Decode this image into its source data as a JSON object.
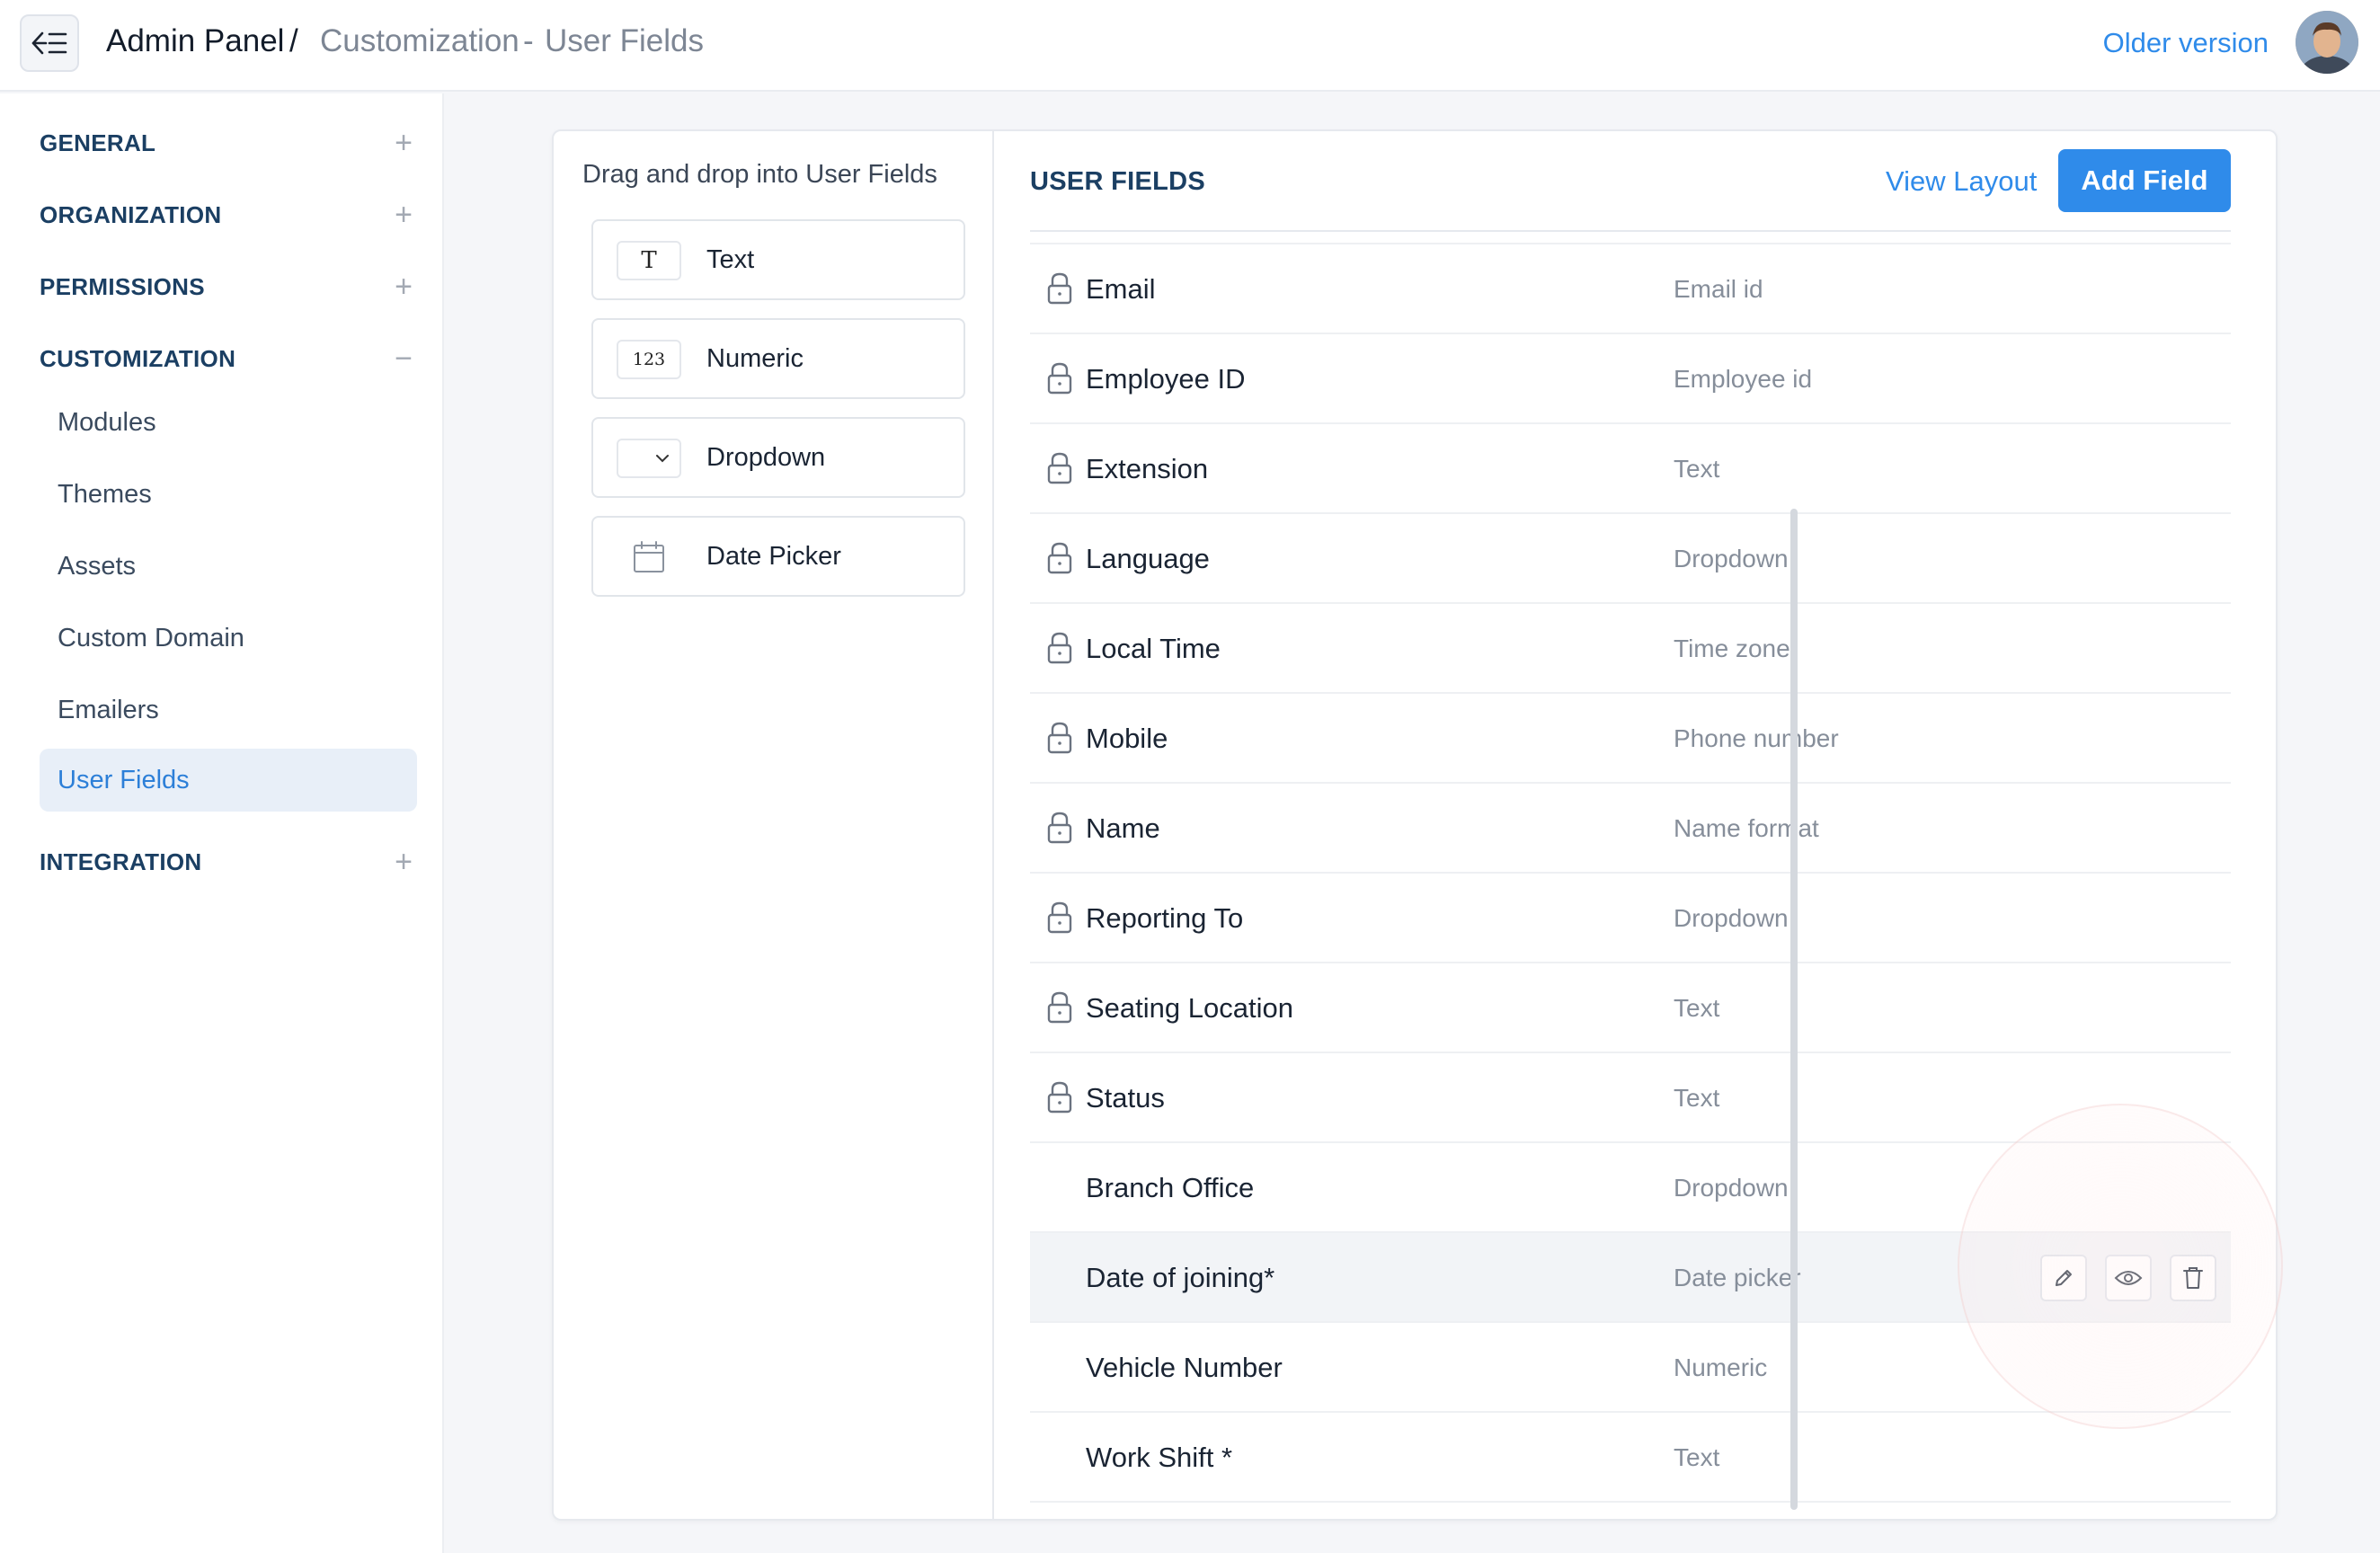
{
  "header": {
    "back_icon": "sidebar-collapse-icon",
    "breadcrumb": {
      "root": "Admin Panel",
      "separator": "/",
      "section": "Customization",
      "dash": "-",
      "page": "User Fields"
    },
    "older_version": "Older version",
    "avatar_icon": "user-avatar"
  },
  "sidebar": {
    "sections": [
      {
        "label": "GENERAL",
        "toggle": "+"
      },
      {
        "label": "ORGANIZATION",
        "toggle": "+"
      },
      {
        "label": "PERMISSIONS",
        "toggle": "+"
      },
      {
        "label": "CUSTOMIZATION",
        "toggle": "−"
      },
      {
        "label": "INTEGRATION",
        "toggle": "+"
      }
    ],
    "customization_items": [
      {
        "label": "Modules"
      },
      {
        "label": "Themes"
      },
      {
        "label": "Assets"
      },
      {
        "label": "Custom Domain"
      },
      {
        "label": "Emailers"
      },
      {
        "label": "User Fields"
      }
    ],
    "active_item": "User Fields"
  },
  "palette": {
    "title": "Drag and drop into User Fields",
    "items": [
      {
        "label": "Text",
        "icon_text": "T",
        "icon": "text-type-icon"
      },
      {
        "label": "Numeric",
        "icon_text": "123",
        "icon": "numeric-type-icon"
      },
      {
        "label": "Dropdown",
        "icon_text": "",
        "icon": "dropdown-type-icon"
      },
      {
        "label": "Date Picker",
        "icon_text": "",
        "icon": "calendar-icon"
      }
    ]
  },
  "user_fields": {
    "title": "USER FIELDS",
    "view_layout": "View Layout",
    "add_field": "Add Field",
    "rows": [
      {
        "name": "Email",
        "type": "Email id",
        "locked": true
      },
      {
        "name": "Employee ID",
        "type": "Employee id",
        "locked": true
      },
      {
        "name": "Extension",
        "type": "Text",
        "locked": true
      },
      {
        "name": "Language",
        "type": "Dropdown",
        "locked": true
      },
      {
        "name": "Local Time",
        "type": "Time zone",
        "locked": true
      },
      {
        "name": "Mobile",
        "type": "Phone number",
        "locked": true
      },
      {
        "name": "Name",
        "type": "Name format",
        "locked": true
      },
      {
        "name": "Reporting To",
        "type": "Dropdown",
        "locked": true
      },
      {
        "name": "Seating Location",
        "type": "Text",
        "locked": true
      },
      {
        "name": "Status",
        "type": "Text",
        "locked": true
      },
      {
        "name": "Branch Office",
        "type": "Dropdown",
        "locked": false
      },
      {
        "name": "Date of joining*",
        "type": "Date picker",
        "locked": false,
        "hovered": true
      },
      {
        "name": "Vehicle Number",
        "type": "Numeric",
        "locked": false
      },
      {
        "name": "Work Shift *",
        "type": "Text",
        "locked": false
      }
    ],
    "row_actions": [
      "edit-icon",
      "eye-icon",
      "trash-icon"
    ]
  },
  "colors": {
    "accent": "#2f8bea",
    "section_label": "#1b3f63",
    "active_bg": "#e8eff8"
  }
}
